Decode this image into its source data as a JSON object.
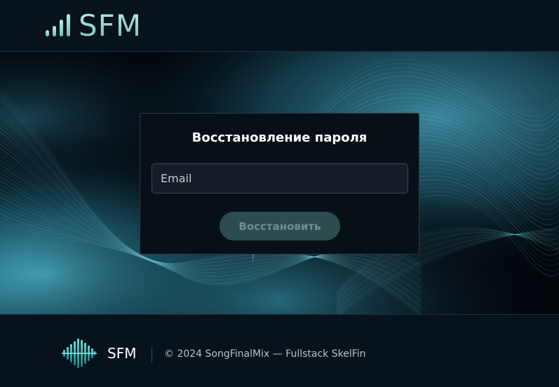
{
  "header": {
    "logo_text": "SFM"
  },
  "recovery_form": {
    "title": "Восстановление пароля",
    "email_placeholder": "Email",
    "email_value": "",
    "submit_label": "Восстановить",
    "submit_disabled": true
  },
  "footer": {
    "brand": "SFM",
    "copyright": "© 2024 SongFinalMix — Fullstack SkelFin"
  },
  "colors": {
    "background": "#07121c",
    "accent": "#4fb3c6",
    "logo_gradient_top": "#b8ece8",
    "logo_gradient_bottom": "#6fbfb9",
    "card_background": "#081017",
    "button_disabled": "#2c4c4f"
  },
  "icons": {
    "header_logo": "sound-bars-icon",
    "footer_logo": "equalizer-icon"
  }
}
